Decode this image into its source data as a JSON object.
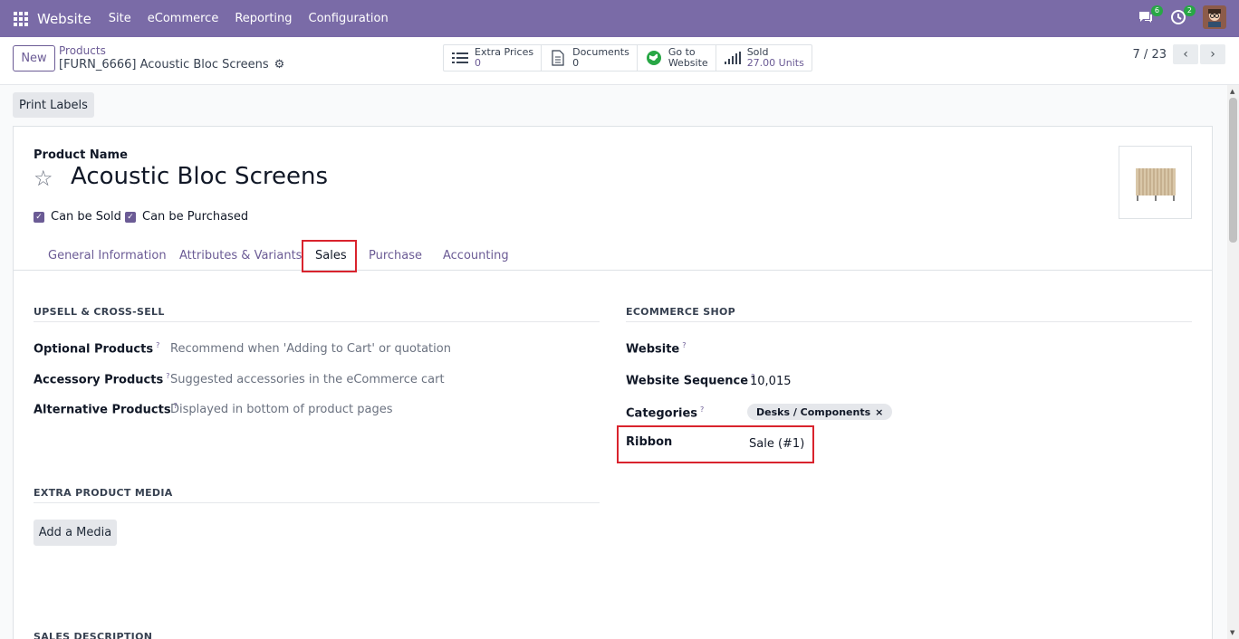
{
  "topnav": {
    "app_name": "Website",
    "menu": [
      "Site",
      "eCommerce",
      "Reporting",
      "Configuration"
    ],
    "messages_count": "6",
    "activities_count": "2"
  },
  "control": {
    "new_label": "New",
    "breadcrumb_parent": "Products",
    "breadcrumb_current": "[FURN_6666] Acoustic Bloc Screens",
    "smart_buttons": [
      {
        "label": "Extra Prices",
        "value": "0"
      },
      {
        "label": "Documents",
        "value": "0"
      },
      {
        "label": "Go to",
        "value": "Website"
      },
      {
        "label": "Sold",
        "value": "27.00 Units"
      }
    ],
    "pager": "7 / 23"
  },
  "actions": {
    "print_labels": "Print Labels"
  },
  "form": {
    "product_name_label": "Product Name",
    "product_name": "Acoustic Bloc Screens",
    "can_be_sold": "Can be Sold",
    "can_be_purchased": "Can be Purchased",
    "tabs": [
      "General Information",
      "Attributes & Variants",
      "Sales",
      "Purchase",
      "Accounting"
    ],
    "active_tab": "Sales",
    "upsell": {
      "title": "UPSELL & CROSS-SELL",
      "rows": [
        {
          "label": "Optional Products",
          "placeholder": "Recommend when 'Adding to Cart' or quotation"
        },
        {
          "label": "Accessory Products",
          "placeholder": "Suggested accessories in the eCommerce cart"
        },
        {
          "label": "Alternative Products",
          "placeholder": "Displayed in bottom of product pages"
        }
      ]
    },
    "ecommerce": {
      "title": "ECOMMERCE SHOP",
      "website_label": "Website",
      "website_value": "",
      "sequence_label": "Website Sequence",
      "sequence_value": "10,015",
      "categories_label": "Categories",
      "category_tag": "Desks / Components",
      "ribbon_label": "Ribbon",
      "ribbon_value": "Sale (#1)"
    },
    "media": {
      "title": "EXTRA PRODUCT MEDIA",
      "add_label": "Add a Media"
    },
    "sales_description_title": "SALES DESCRIPTION"
  },
  "colors": {
    "nav": "#7a6ba7",
    "accent": "#6b5b95",
    "highlight": "#d9232d"
  }
}
